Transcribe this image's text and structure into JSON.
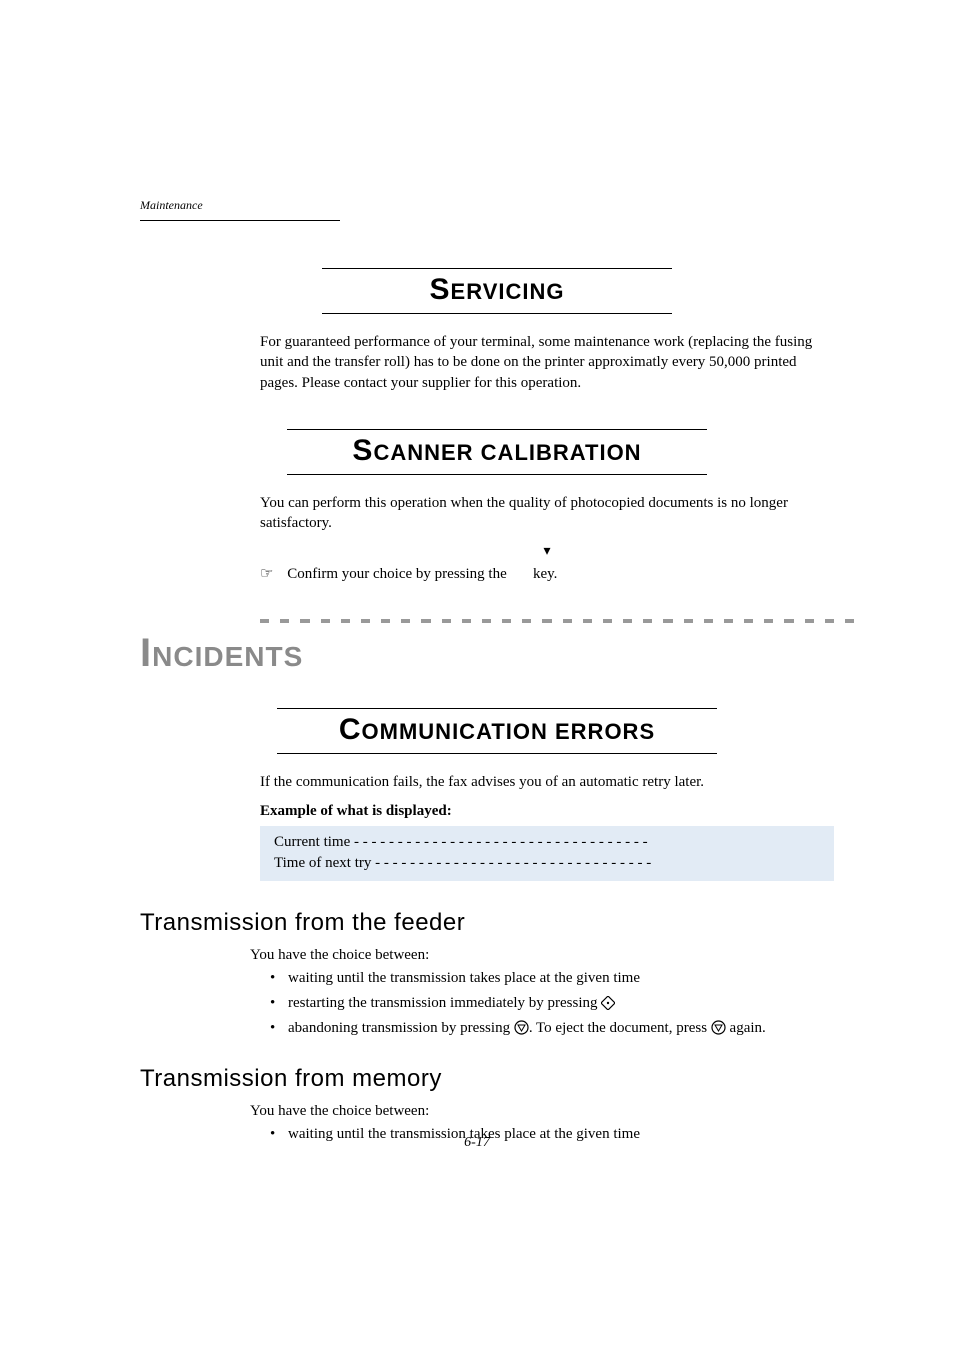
{
  "header": {
    "section_label": "Maintenance"
  },
  "servicing": {
    "heading_first": "S",
    "heading_rest": "ERVICING",
    "para": "For guaranteed performance of your terminal, some maintenance work (replacing the fusing unit and the transfer roll) has to be done on the printer approximatly every 50,000 printed pages. Please contact your supplier for this operation."
  },
  "scanner": {
    "heading_first": "S",
    "heading_rest": "CANNER CALIBRATION",
    "para": "You can perform this operation when the quality of photocopied documents is no longer satisfactory.",
    "arrow": "▾",
    "confirm_prefix": "☞",
    "confirm_text_a": "Confirm your choice by pressing the ",
    "confirm_text_b": " key."
  },
  "incidents": {
    "heading_first": "I",
    "heading_rest": "NCIDENTS"
  },
  "comm_errors": {
    "heading_first": "C",
    "heading_rest": "OMMUNICATION ERRORS",
    "para": "If the communication fails, the fax advises you of an automatic retry later.",
    "example_label": "Example of what is displayed:",
    "line1": "Current time  - - - - - - - - - - - - - - - - - - - - - - - - - - - - - - - - - -",
    "line2": "Time of next try - - - - - - - - - - - - - - - - - - - - - - - - - - - - - - - -"
  },
  "feeder": {
    "heading": "Transmission from the feeder",
    "intro": "You have the choice between:",
    "b1": "waiting until the transmission takes place at the given time",
    "b2_a": "restarting the transmission immediately by pressing ",
    "b3_a": "abandoning transmission by pressing ",
    "b3_b": ". To eject the document, press ",
    "b3_c": " again."
  },
  "memory": {
    "heading": "Transmission from memory",
    "intro": "You have the choice between:",
    "b1": "waiting until the transmission takes place at the given time"
  },
  "footer": {
    "page": "6-17"
  }
}
